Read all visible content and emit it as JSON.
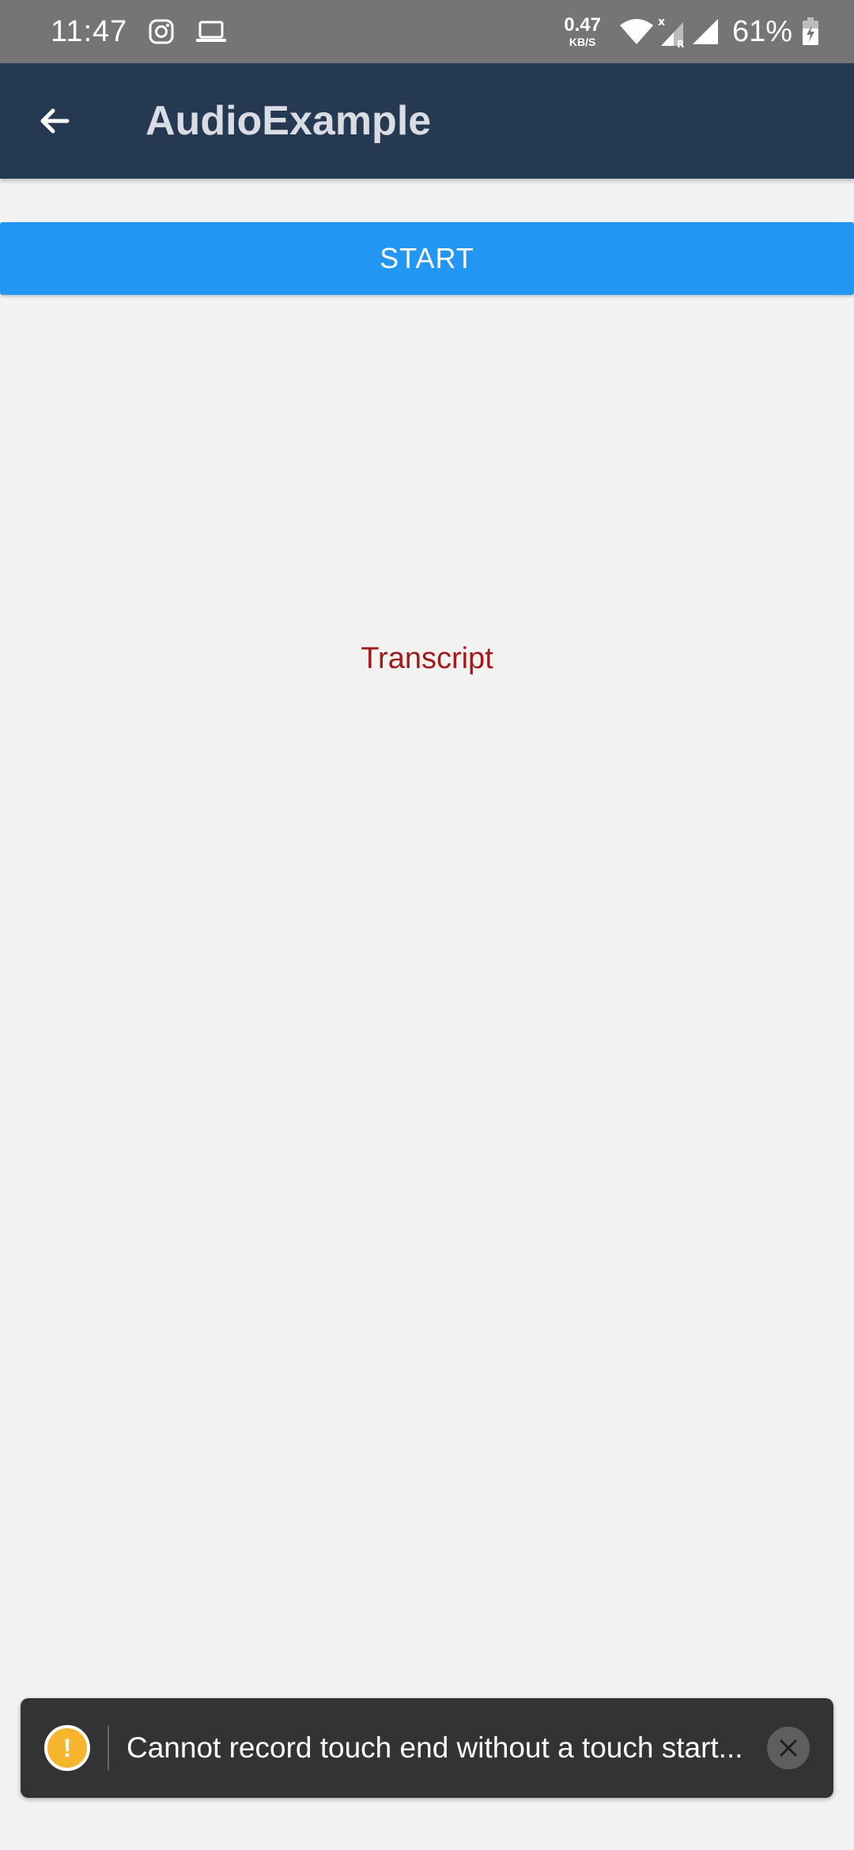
{
  "status_bar": {
    "time": "11:47",
    "network_speed": "0.47",
    "network_unit": "KB/S",
    "battery": "61%",
    "icons": [
      "instagram-icon",
      "laptop-icon",
      "wifi-icon",
      "signal-x-icon",
      "signal-icon",
      "battery-charging-icon"
    ]
  },
  "app_bar": {
    "title": "AudioExample",
    "back_icon": "arrow-left-icon",
    "background": "#263952"
  },
  "main": {
    "start_label": "START",
    "start_color": "#2196f3",
    "transcript": "Transcript",
    "transcript_color": "#a21a1a"
  },
  "toast": {
    "icon": "warning-icon",
    "icon_glyph": "!",
    "message": "Cannot record touch end without a touch start...",
    "close_icon": "close-icon"
  }
}
